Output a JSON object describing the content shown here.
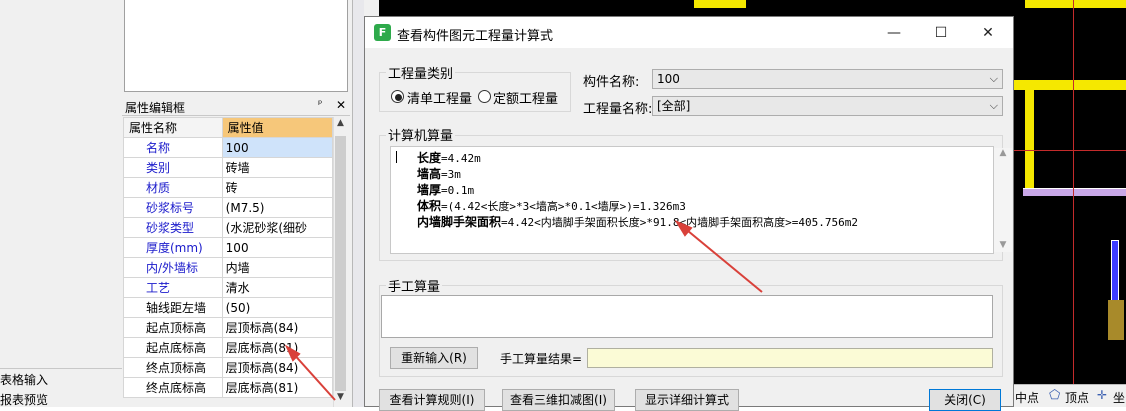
{
  "left_panel": {
    "prop_title": "属性编辑框",
    "pin_glyph": "ᵖ",
    "close_glyph": "✕",
    "header": {
      "name": "属性名称",
      "value": "属性值"
    },
    "rows": [
      {
        "name": "名称",
        "value": "100",
        "blue": true,
        "selected": true
      },
      {
        "name": "类别",
        "value": "砖墙",
        "blue": true
      },
      {
        "name": "材质",
        "value": "砖",
        "blue": true
      },
      {
        "name": "砂浆标号",
        "value": "(M7.5)",
        "blue": true
      },
      {
        "name": "砂浆类型",
        "value": "(水泥砂浆(细砂",
        "blue": true
      },
      {
        "name": "厚度(mm)",
        "value": "100",
        "blue": true
      },
      {
        "name": "内/外墙标",
        "value": "内墙",
        "blue": true
      },
      {
        "name": "工艺",
        "value": "清水",
        "blue": true
      },
      {
        "name": "轴线距左墙",
        "value": "(50)",
        "blue": false
      },
      {
        "name": "起点顶标高",
        "value": "层顶标高(84)",
        "blue": false
      },
      {
        "name": "起点底标高",
        "value": "层底标高(81)",
        "blue": false
      },
      {
        "name": "终点顶标高",
        "value": "层顶标高(84)",
        "blue": false
      },
      {
        "name": "终点底标高",
        "value": "层底标高(81)",
        "blue": false
      }
    ],
    "bottom_items": [
      "表格输入",
      "报表预览"
    ]
  },
  "dialog": {
    "title": "查看构件图元工程量计算式",
    "app_icon": "F",
    "window_buttons": {
      "minimize": "—",
      "maximize": "☐",
      "close": "✕"
    },
    "qty_type_label": "工程量类别",
    "radio_options": [
      {
        "label": "清单工程量",
        "checked": true
      },
      {
        "label": "定额工程量",
        "checked": false
      }
    ],
    "component_name_label": "构件名称:",
    "component_name_value": "100",
    "qty_name_label": "工程量名称:",
    "qty_name_value": "[全部]",
    "computer_calc_label": "计算机算量",
    "calc_lines": [
      {
        "key": "长度",
        "expr": "=4.42m"
      },
      {
        "key": "墙高",
        "expr": "=3m"
      },
      {
        "key": "墙厚",
        "expr": "=0.1m"
      },
      {
        "key": "体积",
        "expr": "=(4.42<长度>*3<墙高>*0.1<墙厚>)=1.326m3"
      },
      {
        "key": "内墙脚手架面积",
        "expr": "=4.42<内墙脚手架面积长度>*91.8<内墙脚手架面积高度>=405.756m2"
      }
    ],
    "manual_calc_label": "手工算量",
    "reenter_button": "重新输入(R)",
    "manual_result_label": "手工算量结果=",
    "manual_result_value": "",
    "view_rules_button": "查看计算规则(I)",
    "view_3d_button": "查看三维扣减图(I)",
    "show_detail_button": "显示详细计算式",
    "close_button": "关闭(C)"
  },
  "cad_bottom": {
    "midpoint": "中点",
    "vertex": "顶点",
    "coord": "坐"
  },
  "colors": {
    "accent_yellow": "#f5e800",
    "annotation_red": "#d9413a",
    "header_orange": "#f6c77a",
    "selected_blue": "#cfe3fa"
  }
}
